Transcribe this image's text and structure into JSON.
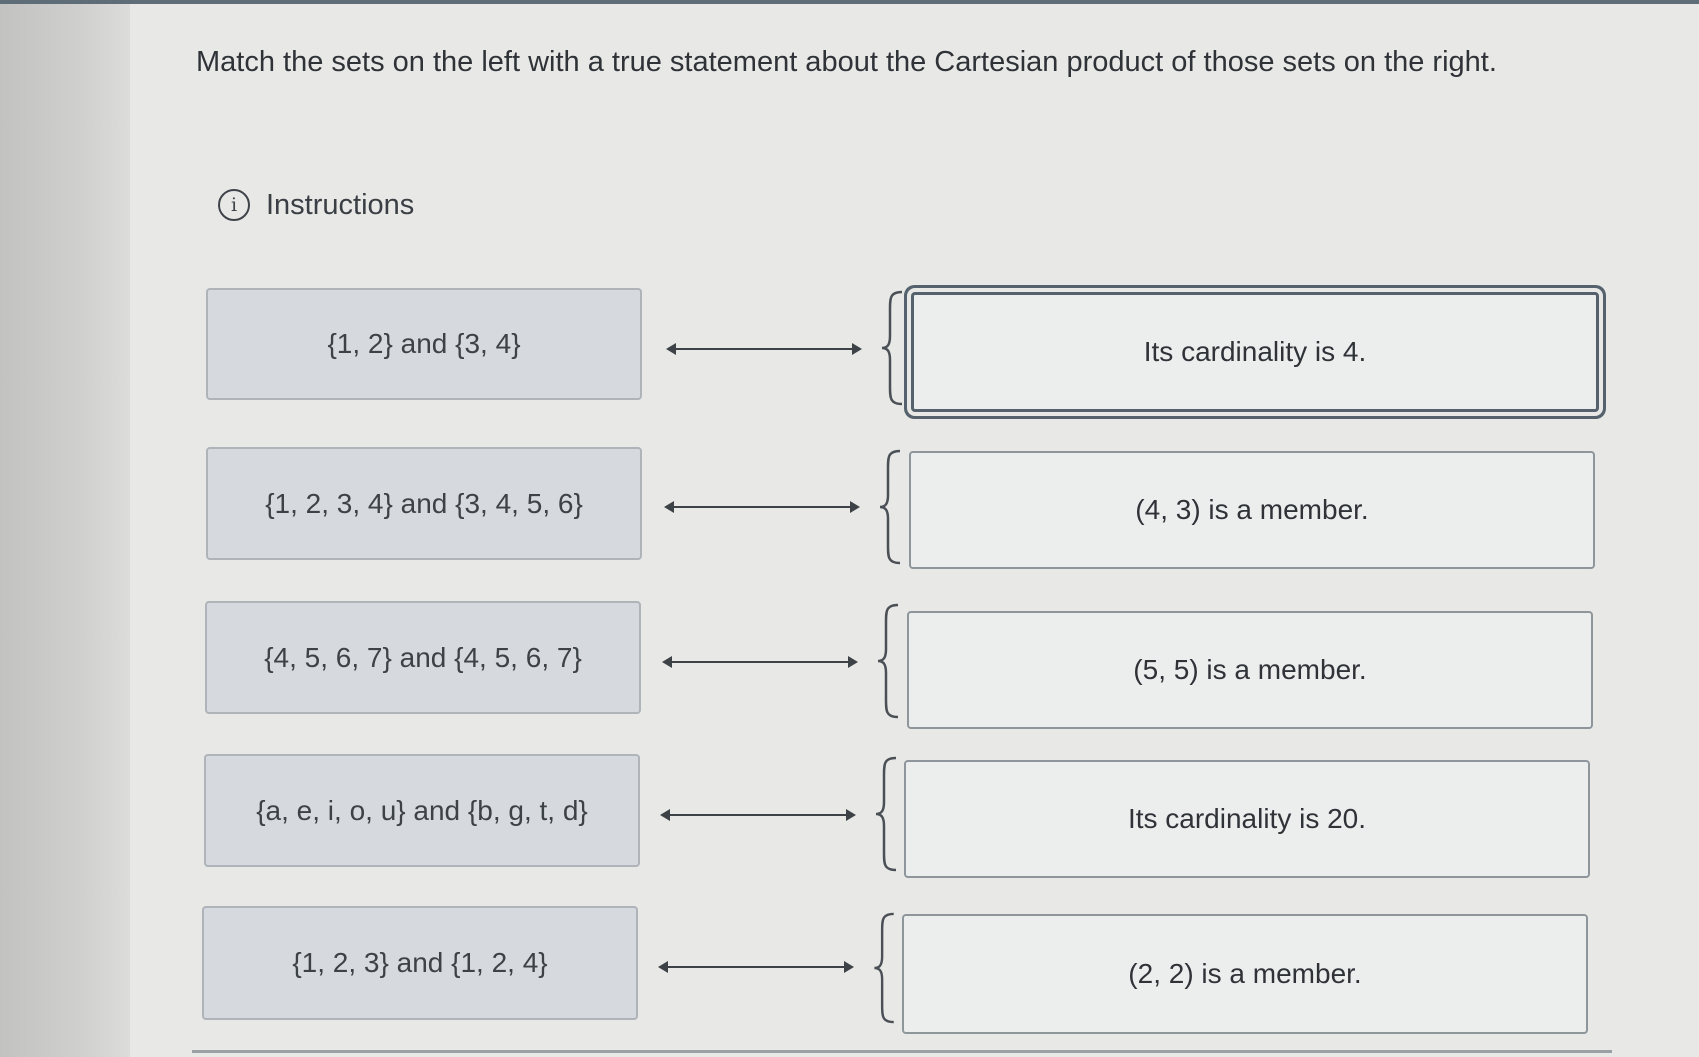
{
  "question": {
    "text": "Match the sets on the left with a true statement about the Cartesian product of those sets on the right."
  },
  "instructions": {
    "icon": "info-icon",
    "icon_glyph": "i",
    "label": "Instructions"
  },
  "matches": [
    {
      "left": "{1, 2} and {3, 4}",
      "right": "Its cardinality is 4.",
      "selected": true
    },
    {
      "left": "{1, 2, 3, 4} and {3, 4, 5, 6}",
      "right": "(4, 3) is a member.",
      "selected": false
    },
    {
      "left": "{4, 5, 6, 7} and {4, 5, 6, 7}",
      "right": "(5, 5) is a member.",
      "selected": false
    },
    {
      "left": "{a, e, i, o, u} and {b, g, t, d}",
      "right": "Its cardinality is 20.",
      "selected": false
    },
    {
      "left": "{1, 2, 3} and {1, 2, 4}",
      "right": "(2, 2) is a member.",
      "selected": false
    }
  ],
  "colors": {
    "left_card_bg": "#d6dade",
    "right_card_bg": "#eceeee",
    "selected_outline": "#55626d",
    "text": "#2f3338"
  }
}
